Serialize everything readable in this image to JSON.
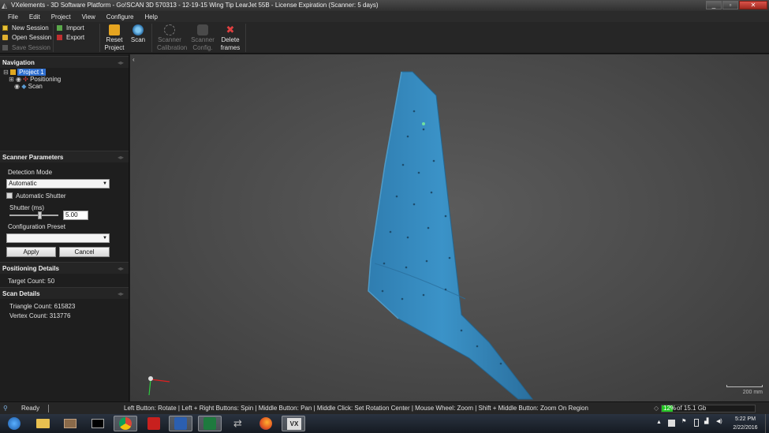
{
  "window": {
    "title": "VXelements - 3D Software Platform - Go!SCAN 3D 570313 - 12-19-15 Wing Tip LearJet 55B - License Expiration (Scanner: 5 days)"
  },
  "menu": [
    "File",
    "Edit",
    "Project",
    "View",
    "Configure",
    "Help"
  ],
  "toolbar": {
    "new_session": "New Session",
    "open_session": "Open Session",
    "save_session": "Save Session",
    "import": "Import",
    "export": "Export",
    "reset_project": [
      "Reset",
      "Project"
    ],
    "scan": "Scan",
    "scanner_calibration": [
      "Scanner",
      "Calibration"
    ],
    "scanner_config": [
      "Scanner",
      "Config."
    ],
    "delete_frames": [
      "Delete",
      "frames"
    ]
  },
  "navigation": {
    "header": "Navigation",
    "project": "Project 1",
    "positioning": "Positioning",
    "scan": "Scan"
  },
  "scanner_params": {
    "header": "Scanner Parameters",
    "detection_mode_label": "Detection Mode",
    "detection_mode_value": "Automatic",
    "automatic_shutter_label": "Automatic Shutter",
    "automatic_shutter_checked": false,
    "shutter_label": "Shutter (ms)",
    "shutter_value": "5.00",
    "shutter_slider_level": 0.62,
    "config_preset_label": "Configuration Preset",
    "config_preset_value": "",
    "apply": "Apply",
    "cancel": "Cancel"
  },
  "positioning_details": {
    "header": "Positioning Details",
    "target_count": "Target Count: 50"
  },
  "scan_details": {
    "header": "Scan Details",
    "triangle_count": "Triangle Count: 615823",
    "vertex_count": "Vertex Count: 313776"
  },
  "viewport": {
    "scale_label": "200 mm",
    "model_color": "#3a8cbf"
  },
  "status": {
    "state": "Ready",
    "hints": "Left Button: Rotate  |  Left + Right Buttons: Spin  |  Middle Button: Pan  |  Middle Click: Set Rotation Center  |  Mouse Wheel: Zoom  |  Shift + Middle Button: Zoom On Region",
    "memory_percent": "12%",
    "memory_total": "of 15.1 Gb",
    "memory_level": 0.12
  },
  "taskbar": {
    "time": "5:22 PM",
    "date": "2/22/2016"
  },
  "colors": {
    "accent": "#2f6fd0",
    "memory_green": "#22c322"
  }
}
